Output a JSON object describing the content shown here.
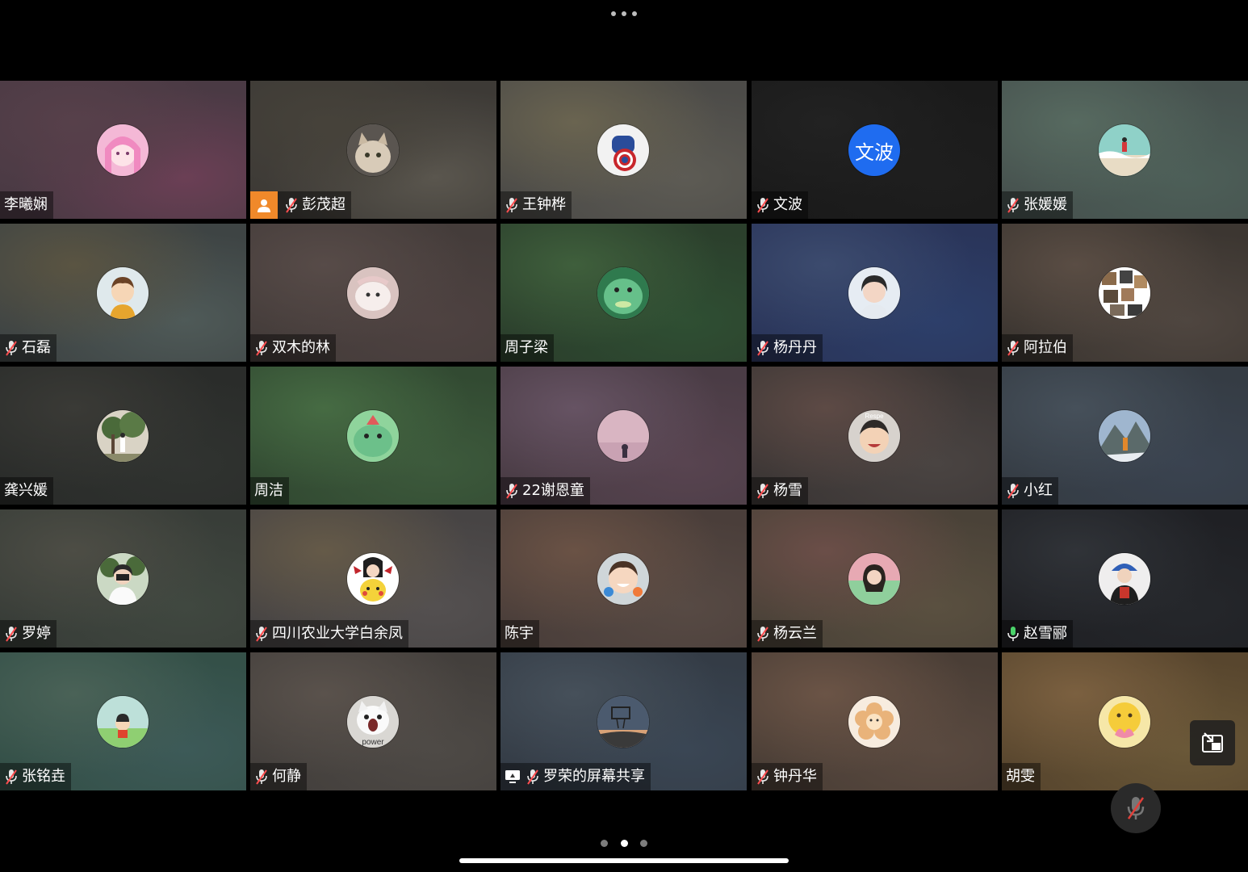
{
  "pagination": {
    "pages": 3,
    "current": 2
  },
  "participants": [
    {
      "name": "李曦娴",
      "mic": "none",
      "avatar": "anime-girl-pink-hair"
    },
    {
      "name": "彭茂超",
      "mic": "muted",
      "host": true,
      "avatar": "cat-photo"
    },
    {
      "name": "王钟桦",
      "mic": "muted",
      "avatar": "captain-america-cartoon"
    },
    {
      "name": "文波",
      "mic": "muted",
      "avatar_text": "文波",
      "avatar_color": "#1f6cf0"
    },
    {
      "name": "张媛媛",
      "mic": "muted",
      "avatar": "beach-figure"
    },
    {
      "name": "石磊",
      "mic": "muted",
      "avatar": "cartoon-boy"
    },
    {
      "name": "双木的林",
      "mic": "muted",
      "avatar": "white-dog"
    },
    {
      "name": "周子梁",
      "mic": "none",
      "avatar": "green-dinosaur"
    },
    {
      "name": "杨丹丹",
      "mic": "muted",
      "avatar": "girl-portrait"
    },
    {
      "name": "阿拉伯",
      "mic": "muted",
      "avatar": "cat-collage"
    },
    {
      "name": "龚兴媛",
      "mic": "none",
      "avatar": "girl-under-tree"
    },
    {
      "name": "周洁",
      "mic": "none",
      "avatar": "green-dinosaur-hat"
    },
    {
      "name": "22谢恩童",
      "mic": "muted",
      "avatar": "pink-sky-silhouette"
    },
    {
      "name": "杨雪",
      "mic": "muted",
      "avatar": "laughing-child",
      "avatar_caption": "Respe"
    },
    {
      "name": "小红",
      "mic": "muted",
      "avatar": "mountain-hiker"
    },
    {
      "name": "罗婷",
      "mic": "muted",
      "avatar": "girl-with-camera"
    },
    {
      "name": "四川农业大学白余凤",
      "mic": "muted",
      "avatar": "pikachu-girl"
    },
    {
      "name": "陈宇",
      "mic": "none",
      "avatar": "smiling-child"
    },
    {
      "name": "杨云兰",
      "mic": "muted",
      "avatar": "girl-pink-background"
    },
    {
      "name": "赵雪郦",
      "mic": "active",
      "speaking": true,
      "avatar": "person-in-blue-hat"
    },
    {
      "name": "张铭垚",
      "mic": "muted",
      "avatar": "cartoon-kid-field"
    },
    {
      "name": "何静",
      "mic": "muted",
      "avatar": "screaming-cat",
      "avatar_caption": "power"
    },
    {
      "name": "罗荣的屏幕共享",
      "mic": "muted",
      "screen_share": true,
      "avatar": "basketball-hoop-sunset"
    },
    {
      "name": "钟丹华",
      "mic": "muted",
      "avatar": "flower-cartoon"
    },
    {
      "name": "胡雯",
      "mic": "none",
      "avatar": "emoji-with-lotus"
    }
  ],
  "colors": {
    "active_border": "#4bd36a",
    "host_badge": "#f0892a",
    "muted_icon": "#ff4d4f"
  }
}
